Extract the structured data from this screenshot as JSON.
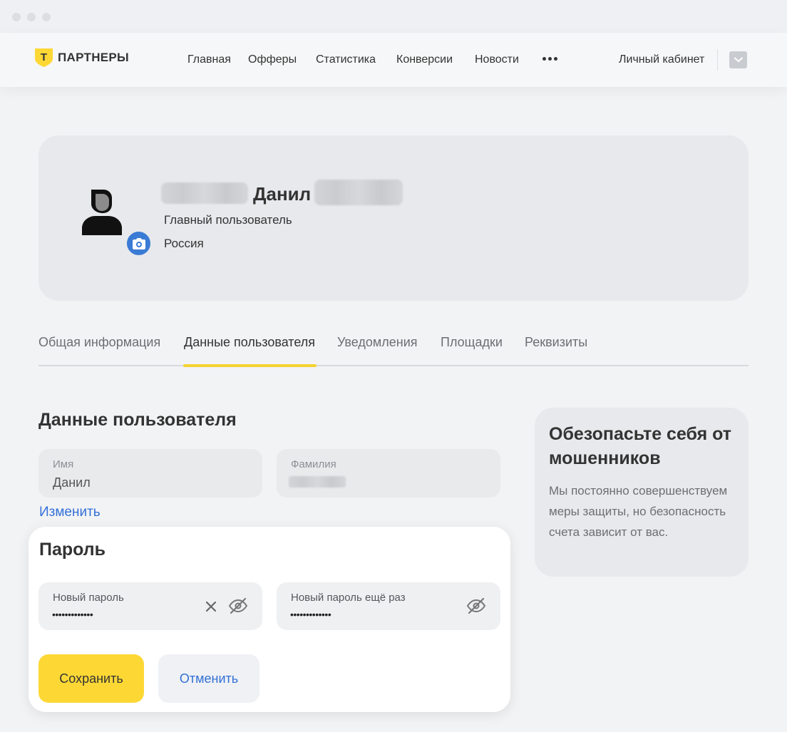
{
  "brand": {
    "name": "ПАРТНЕРЫ",
    "logo_letter": "Т"
  },
  "nav": {
    "items": [
      "Главная",
      "Офферы",
      "Статистика",
      "Конверсии",
      "Новости"
    ],
    "cabinet": "Личный кабинет"
  },
  "profile": {
    "name": "Данил",
    "role": "Главный пользователь",
    "country": "Россия"
  },
  "tabs": [
    "Общая информация",
    "Данные пользователя",
    "Уведомления",
    "Площадки",
    "Реквизиты"
  ],
  "active_tab": "Данные пользователя",
  "user_data": {
    "title": "Данные пользователя",
    "first_name_label": "Имя",
    "first_name_value": "Данил",
    "last_name_label": "Фамилия",
    "edit_link": "Изменить"
  },
  "password": {
    "title": "Пароль",
    "new_label": "Новый пароль",
    "new_value": "•••••••••••••",
    "repeat_label": "Новый пароль ещё раз",
    "repeat_value": "•••••••••••••",
    "save": "Сохранить",
    "cancel": "Отменить"
  },
  "security": {
    "title": "Обезопасьте себя от мошенников",
    "text": "Мы постоянно совершенствуем меры защиты, но безопасность счета зависит от вас."
  },
  "colors": {
    "accent": "#fdd835",
    "link": "#3370d6",
    "card": "#e8e9ec",
    "camera_badge": "#3a7bd5"
  }
}
